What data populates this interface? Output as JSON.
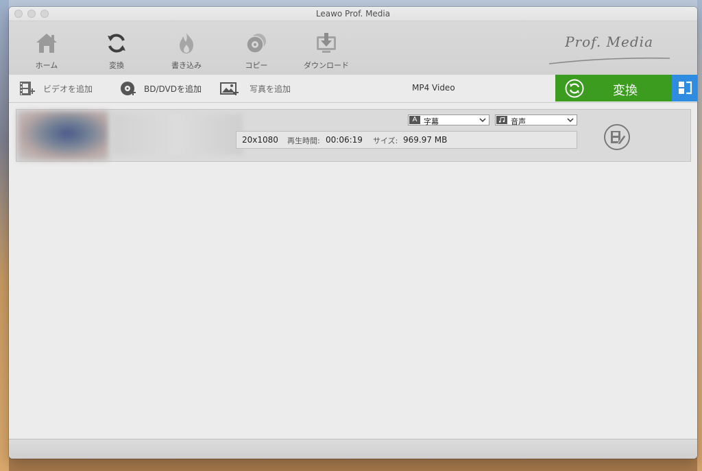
{
  "window": {
    "title": "Leawo Prof. Media"
  },
  "toolbar": {
    "items": [
      {
        "label": "ホーム",
        "icon": "home-icon"
      },
      {
        "label": "変換",
        "icon": "convert-icon"
      },
      {
        "label": "書き込み",
        "icon": "burn-icon"
      },
      {
        "label": "コピー",
        "icon": "disc-copy-icon"
      },
      {
        "label": "ダウンロード",
        "icon": "download-icon"
      }
    ],
    "brand": "Prof. Media"
  },
  "actions": {
    "add_video": "ビデオを追加",
    "add_bd_dvd": "BD/DVDを追加",
    "add_photo": "写真を追加",
    "profile": "MP4 Video",
    "convert": "変換",
    "convert_color": "#3c9c1f",
    "side_panel_color": "#2e8de0"
  },
  "file": {
    "subtitle_badge": "A",
    "subtitle": "字幕",
    "audio": "音声",
    "resolution": "20x1080",
    "duration_label": "再生時間:",
    "duration": "00:06:19",
    "size_label": "サイズ:",
    "size": "969.97 MB"
  }
}
